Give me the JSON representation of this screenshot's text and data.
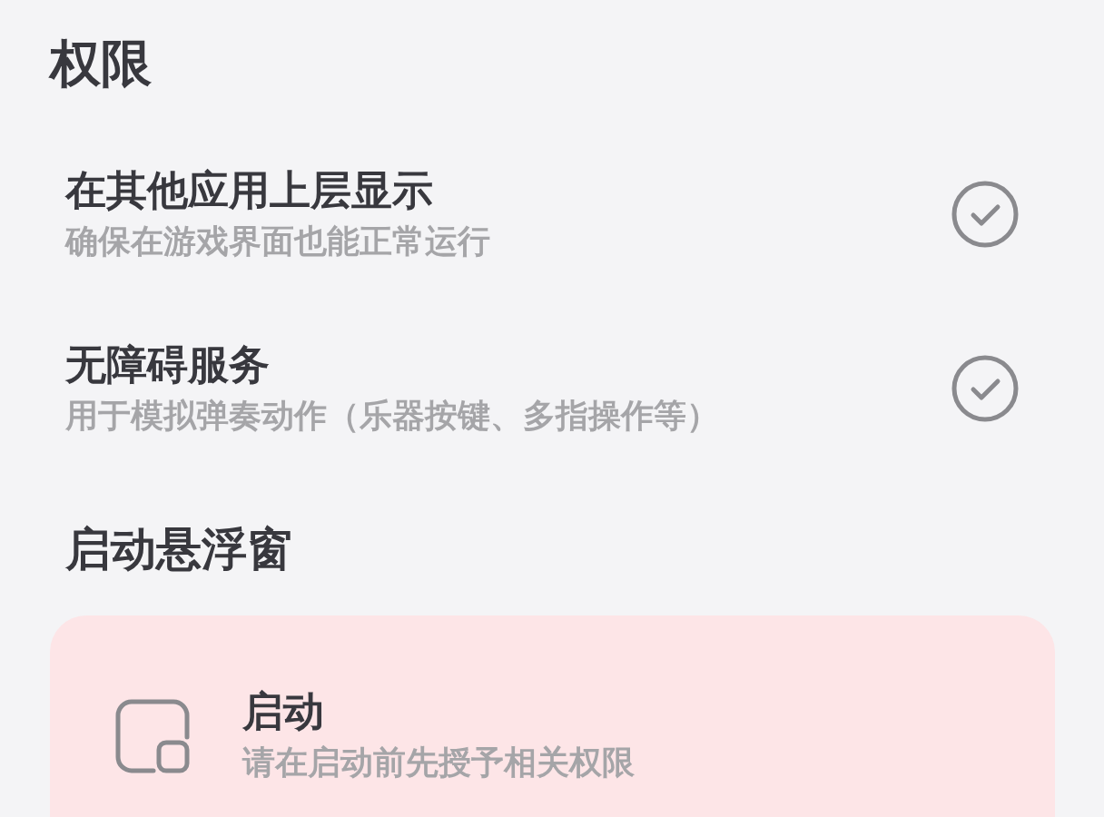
{
  "section_title": "权限",
  "permissions": [
    {
      "title": "在其他应用上层显示",
      "subtitle": "确保在游戏界面也能正常运行",
      "granted": true
    },
    {
      "title": "无障碍服务",
      "subtitle": "用于模拟弹奏动作（乐器按键、多指操作等）",
      "granted": true
    }
  ],
  "launch_section": {
    "title": "启动悬浮窗",
    "card": {
      "title": "启动",
      "subtitle": "请在启动前先授予相关权限"
    }
  }
}
